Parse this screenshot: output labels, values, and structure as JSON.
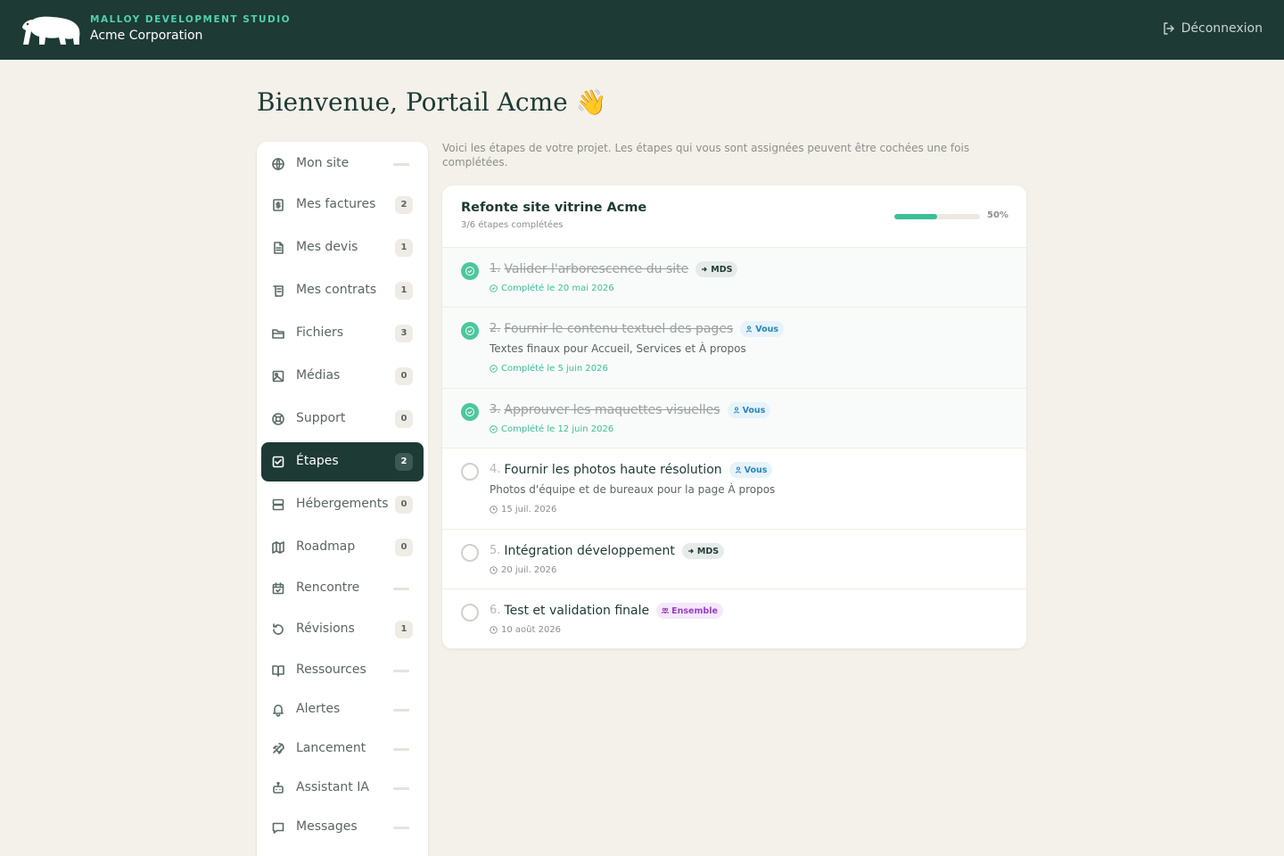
{
  "header": {
    "studio": "MALLOY DEVELOPMENT STUDIO",
    "company": "Acme Corporation",
    "logout_label": "Déconnexion",
    "logout_icon": "logout-icon"
  },
  "page": {
    "title": "Bienvenue, Portail Acme",
    "wave": "👋"
  },
  "sidebar": {
    "items": [
      {
        "label": "Mon site",
        "badge": null,
        "icon": "globe-icon"
      },
      {
        "label": "Mes factures",
        "badge": "2",
        "icon": "invoice-icon"
      },
      {
        "label": "Mes devis",
        "badge": "1",
        "icon": "document-icon"
      },
      {
        "label": "Mes contrats",
        "badge": "1",
        "icon": "scroll-icon"
      },
      {
        "label": "Fichiers",
        "badge": "3",
        "icon": "folder-icon"
      },
      {
        "label": "Médias",
        "badge": "0",
        "icon": "image-icon"
      },
      {
        "label": "Support",
        "badge": "0",
        "icon": "lifebuoy-icon"
      },
      {
        "label": "Étapes",
        "badge": "2",
        "icon": "checkbox-icon",
        "active": true
      },
      {
        "label": "Hébergements",
        "badge": "0",
        "icon": "server-icon"
      },
      {
        "label": "Roadmap",
        "badge": "0",
        "icon": "map-icon"
      },
      {
        "label": "Rencontre",
        "badge": null,
        "icon": "calendar-check-icon"
      },
      {
        "label": "Révisions",
        "badge": "1",
        "icon": "rotate-icon"
      },
      {
        "label": "Ressources",
        "badge": null,
        "icon": "book-icon"
      },
      {
        "label": "Alertes",
        "badge": null,
        "icon": "bell-icon"
      },
      {
        "label": "Lancement",
        "badge": null,
        "icon": "rocket-icon"
      },
      {
        "label": "Assistant IA",
        "badge": null,
        "icon": "bot-icon"
      },
      {
        "label": "Messages",
        "badge": null,
        "icon": "message-icon"
      }
    ]
  },
  "main": {
    "intro": "Voici les étapes de votre projet. Les étapes qui vous sont assignées peuvent être cochées une fois complétées.",
    "project": {
      "title": "Refonte site vitrine Acme",
      "subtitle": "3/6 étapes complétées",
      "progress": 50,
      "progress_label": "50%"
    },
    "steps": [
      {
        "num": "1.",
        "name": "Valider l'arborescence du site",
        "tag": "MDS",
        "tag_type": "mds",
        "desc": null,
        "meta": "Complété le 20 mai 2026",
        "done": true
      },
      {
        "num": "2.",
        "name": "Fournir le contenu textuel des pages",
        "tag": "Vous",
        "tag_type": "vous",
        "desc": "Textes finaux pour Accueil, Services et À propos",
        "meta": "Complété le 5 juin 2026",
        "done": true
      },
      {
        "num": "3.",
        "name": "Approuver les maquettes visuelles",
        "tag": "Vous",
        "tag_type": "vous",
        "desc": null,
        "meta": "Complété le 12 juin 2026",
        "done": true
      },
      {
        "num": "4.",
        "name": "Fournir les photos haute résolution",
        "tag": "Vous",
        "tag_type": "vous",
        "desc": "Photos d'équipe et de bureaux pour la page À propos",
        "meta": "15 juil. 2026",
        "done": false
      },
      {
        "num": "5.",
        "name": "Intégration développement",
        "tag": "MDS",
        "tag_type": "mds",
        "desc": null,
        "meta": "20 juil. 2026",
        "done": false
      },
      {
        "num": "6.",
        "name": "Test et validation finale",
        "tag": "Ensemble",
        "tag_type": "ens",
        "desc": null,
        "meta": "10 août 2026",
        "done": false
      }
    ]
  },
  "colors": {
    "header_bg": "#1e3a34",
    "accent": "#4fd1b0",
    "done_green": "#4dc79c",
    "page_bg": "#f4f0ea"
  }
}
